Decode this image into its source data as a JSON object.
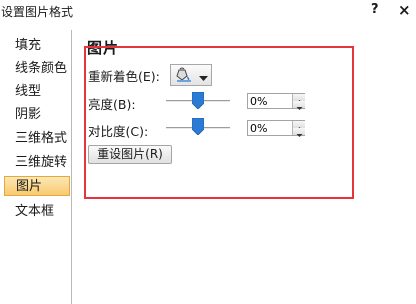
{
  "window": {
    "title": "设置图片格式",
    "help_label": "?",
    "close_label": "×"
  },
  "sidebar": {
    "items": [
      {
        "label": "填充",
        "selected": false
      },
      {
        "label": "线条颜色",
        "selected": false
      },
      {
        "label": "线型",
        "selected": false
      },
      {
        "label": "阴影",
        "selected": false
      },
      {
        "label": "三维格式",
        "selected": false
      },
      {
        "label": "三维旋转",
        "selected": false
      },
      {
        "label": "图片",
        "selected": true
      },
      {
        "label": "文本框",
        "selected": false
      }
    ]
  },
  "picture": {
    "section_title": "图片",
    "recolor_label": "重新着色(E):",
    "brightness_label": "亮度(B):",
    "brightness_value": "0%",
    "brightness_level": 0,
    "contrast_label": "对比度(C):",
    "contrast_value": "0%",
    "contrast_level": 0,
    "reset_label": "重设图片(R)"
  },
  "colors": {
    "highlight_border": "#e5343b",
    "selected_item_bg": "#f8c970",
    "slider_thumb": "#2b7bd5"
  }
}
